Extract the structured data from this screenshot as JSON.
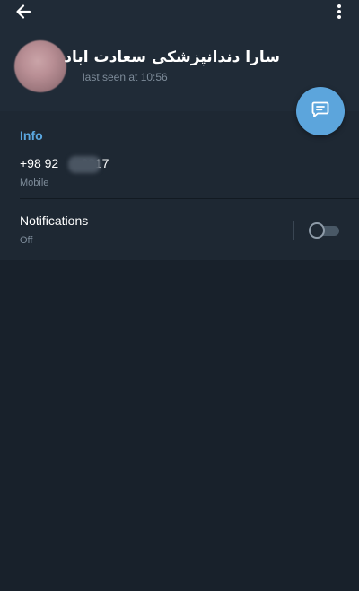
{
  "header": {
    "contact_name": "سارا دندانپزشکی سعادت اباد",
    "last_seen": "last seen at 10:56",
    "icons": {
      "back": "arrow-left-icon",
      "more": "more-vertical-icon"
    }
  },
  "fab": {
    "icon": "message-icon",
    "color": "#5ca5dc"
  },
  "info": {
    "title": "Info",
    "phone_prefix": "+98 92",
    "phone_suffix": "6817",
    "phone_type": "Mobile"
  },
  "notifications": {
    "label": "Notifications",
    "state": "Off",
    "enabled": false
  },
  "colors": {
    "background": "#18212b",
    "header": "#202b37",
    "accent": "#5aa7e0"
  }
}
